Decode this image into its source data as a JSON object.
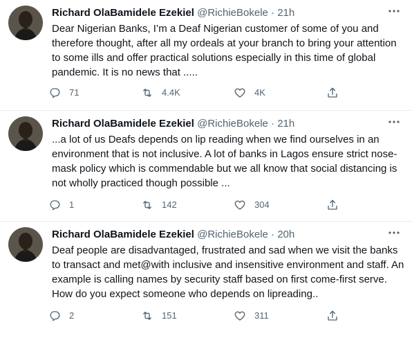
{
  "tweets": [
    {
      "name": "Richard OlaBamidele Ezekiel",
      "handle": "@RichieBokele",
      "separator": "·",
      "time": "21h",
      "text": "Dear Nigerian Banks, I’m a Deaf Nigerian customer of some of you and therefore thought, after all my ordeals at your branch to bring your attention to some ills and offer practical solutions especially in this time of global pandemic. It is no news that .....",
      "replies": "71",
      "retweets": "4.4K",
      "likes": "4K"
    },
    {
      "name": "Richard OlaBamidele Ezekiel",
      "handle": "@RichieBokele",
      "separator": "·",
      "time": "21h",
      "text": "...a lot of us Deafs depends on lip reading when we find ourselves in an environment that is not inclusive. A lot of banks in Lagos ensure strict nose-mask policy which is commendable but we all know that social distancing is not wholly practiced though possible ...",
      "replies": "1",
      "retweets": "142",
      "likes": "304"
    },
    {
      "name": "Richard OlaBamidele Ezekiel",
      "handle": "@RichieBokele",
      "separator": "·",
      "time": "20h",
      "text": "Deaf people are disadvantaged, frustrated and sad when we visit the banks to transact and met@with inclusive and insensitive environment and staff. An example is calling names by security staff based on first come-first serve. How do you expect someone who depends on lipreading..",
      "replies": "2",
      "retweets": "151",
      "likes": "311"
    }
  ],
  "icons": {
    "more": "more-horizontal-icon",
    "reply": "reply-icon",
    "retweet": "retweet-icon",
    "like": "heart-icon",
    "share": "share-icon"
  },
  "colors": {
    "text": "#0f1419",
    "secondary": "#536471",
    "divider": "#e6ecf0",
    "avatar_bg": "#3f3a33"
  }
}
